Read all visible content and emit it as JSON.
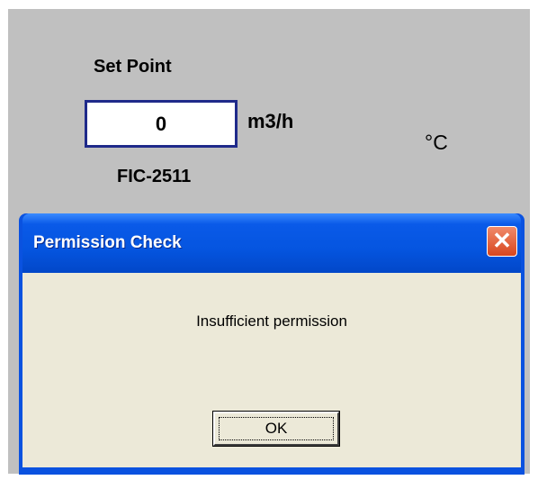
{
  "panel": {
    "setpoint_label": "Set Point",
    "setpoint_value": "0",
    "flow_unit": "m3/h",
    "temp_unit": "°C",
    "tag": "FIC-2511"
  },
  "dialog": {
    "title": "Permission Check",
    "close_glyph": "✕",
    "message": "Insufficient permission",
    "ok_label": "OK"
  }
}
